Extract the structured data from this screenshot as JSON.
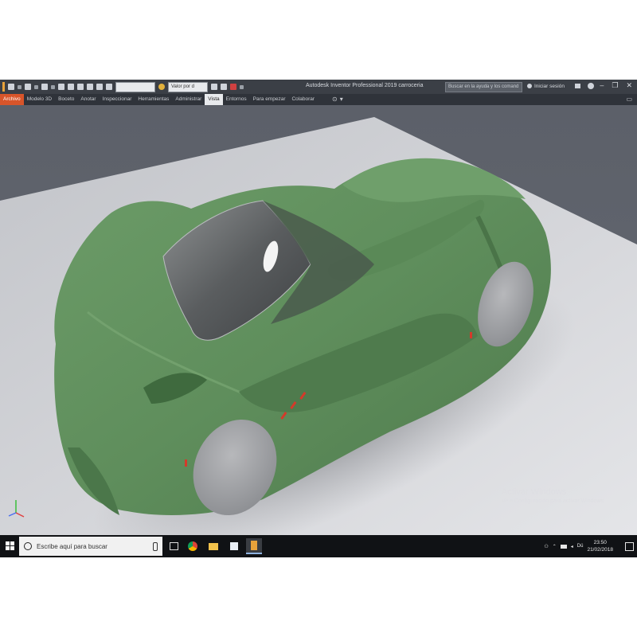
{
  "window": {
    "title": "Autodesk Inventor Professional 2019   carroceria",
    "controls": {
      "minimize": "–",
      "maximize": "❐",
      "close": "✕"
    }
  },
  "quick_access": {
    "dropdown_material": "",
    "dropdown_appearance": "Valor por d",
    "search_placeholder": "Buscar en la ayuda y los comand",
    "sign_in_label": "Iniciar sesión"
  },
  "ribbon": {
    "tabs": [
      {
        "label": "Archivo",
        "state": "file"
      },
      {
        "label": "Modelo 3D",
        "state": ""
      },
      {
        "label": "Boceto",
        "state": ""
      },
      {
        "label": "Anotar",
        "state": ""
      },
      {
        "label": "Inspeccionar",
        "state": ""
      },
      {
        "label": "Herramientas",
        "state": ""
      },
      {
        "label": "Administrar",
        "state": ""
      },
      {
        "label": "Vista",
        "state": "active"
      },
      {
        "label": "Entornos",
        "state": ""
      },
      {
        "label": "Para empezar",
        "state": ""
      },
      {
        "label": "Colaborar",
        "state": ""
      }
    ]
  },
  "viewport": {
    "watermark_title": "Activar Windows",
    "watermark_subtitle": "Ve a Configuración para activar Windows.",
    "model_color": "#5f8e5c"
  },
  "taskbar": {
    "search_placeholder": "Escribe aquí para buscar",
    "tray_language": "Dü",
    "clock_time": "23:50",
    "clock_date": "21/02/2018"
  },
  "colors": {
    "file_tab": "#d8552a",
    "title_bar": "#3b3f46",
    "taskbar": "#101215"
  }
}
